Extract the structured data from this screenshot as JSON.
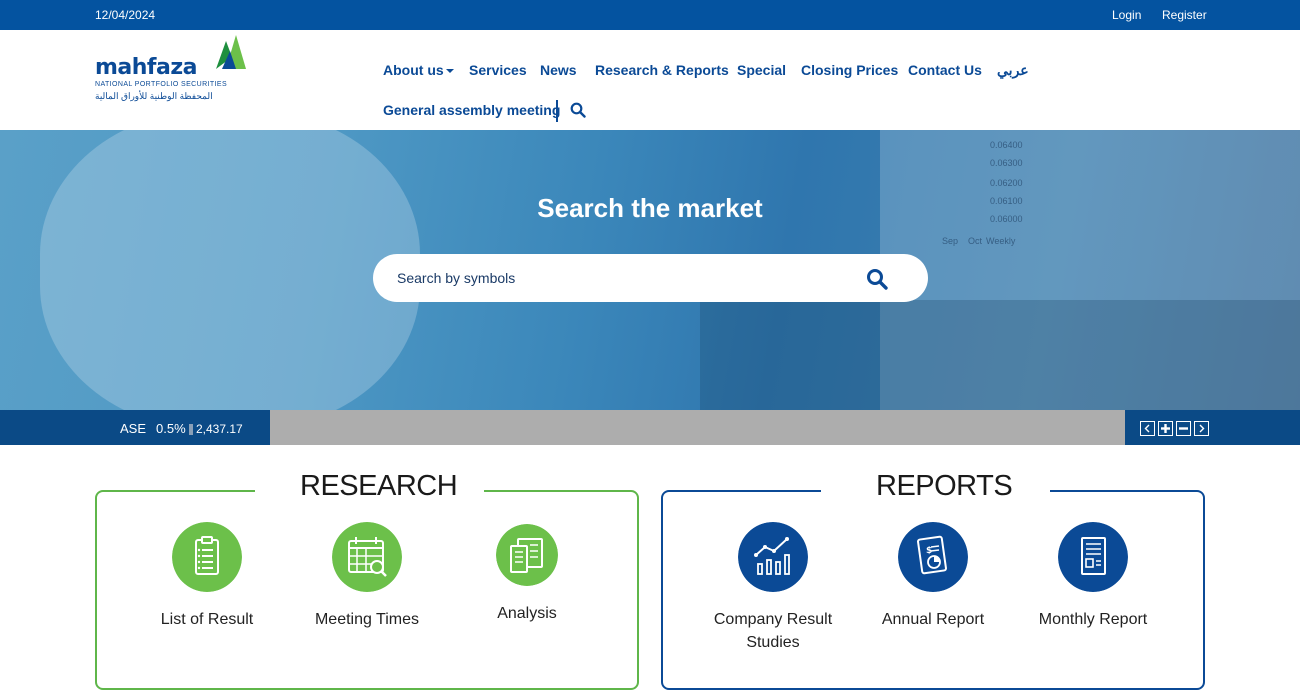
{
  "topbar": {
    "date": "12/04/2024",
    "login": "Login",
    "register": "Register"
  },
  "logo": {
    "wordmark": "mahfaza",
    "tagline": "NATIONAL PORTFOLIO SECURITIES",
    "arabic": "المحفظة الوطنية للأوراق المالية"
  },
  "nav": {
    "items": [
      "About us",
      "Services",
      "News",
      "Research & Reports",
      "Special",
      "Closing Prices",
      "Contact Us",
      "عربي",
      "General assembly meeting"
    ]
  },
  "hero": {
    "title": "Search the market",
    "search_placeholder": "Search by symbols",
    "monitor_values": [
      "0.06400",
      "0.06300",
      "0.06200",
      "0.06100",
      "0.06000",
      "Sep",
      "Oct",
      "Weekly"
    ]
  },
  "ticker": {
    "symbol": "ASE",
    "change": "0.5%",
    "value": "2,437.17"
  },
  "research": {
    "title": "RESEARCH",
    "items": [
      "List of Result",
      "Meeting Times",
      "Analysis"
    ]
  },
  "reports": {
    "title": "REPORTS",
    "items": [
      "Company Result Studies",
      "Annual Report",
      "Monthly Report"
    ]
  },
  "colors": {
    "brand_blue": "#0453a0",
    "nav_blue": "#0b4a96",
    "green": "#5fb64a",
    "ticker_gray": "#adadad"
  }
}
